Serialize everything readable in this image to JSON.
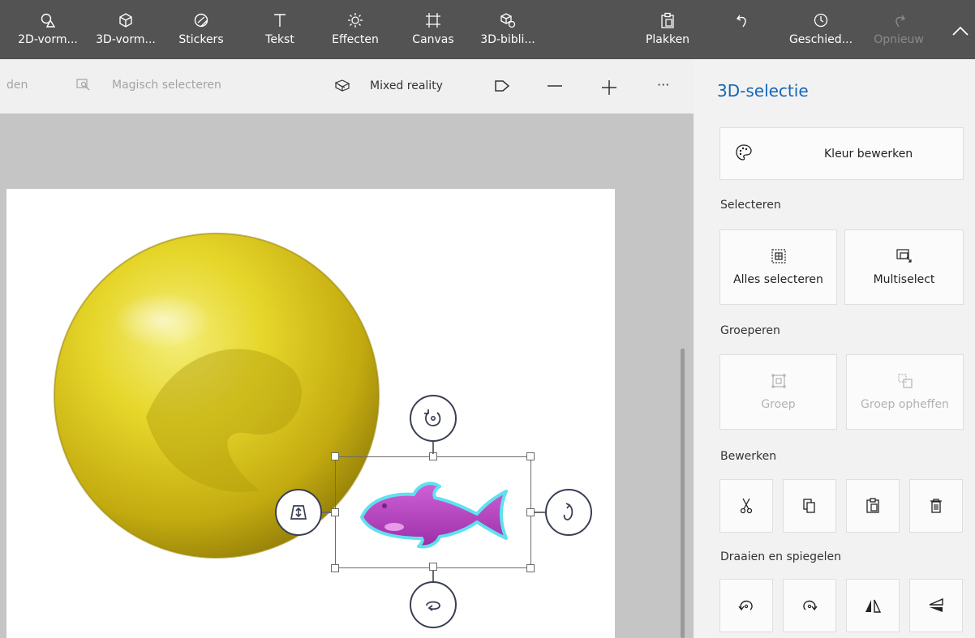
{
  "ribbon": {
    "items": [
      {
        "label": "2D-vorm...",
        "icon": "2d-shapes-icon"
      },
      {
        "label": "3D-vorm...",
        "icon": "3d-shapes-icon"
      },
      {
        "label": "Stickers",
        "icon": "stickers-icon"
      },
      {
        "label": "Tekst",
        "icon": "text-icon"
      },
      {
        "label": "Effecten",
        "icon": "effects-icon"
      },
      {
        "label": "Canvas",
        "icon": "canvas-icon"
      },
      {
        "label": "3D-bibli...",
        "icon": "3d-library-icon"
      },
      {
        "label": "Plakken",
        "icon": "paste-icon"
      },
      {
        "label": "Geschied...",
        "icon": "history-icon"
      },
      {
        "label": "Opnieuw",
        "icon": "redo-icon"
      }
    ]
  },
  "toolbar": {
    "partial_label": "den",
    "magic_select": "Magisch selecteren",
    "mixed_reality": "Mixed reality",
    "more": "···"
  },
  "panel": {
    "title": "3D-selectie",
    "edit_color": "Kleur bewerken",
    "select_header": "Selecteren",
    "select_all": "Alles selecteren",
    "multiselect": "Multiselect",
    "group_header": "Groeperen",
    "group": "Groep",
    "ungroup": "Groep opheffen",
    "edit_header": "Bewerken",
    "rotate_header": "Draaien en spiegelen"
  },
  "colors": {
    "ribbon": "#535353",
    "accent": "#1565b7",
    "sphere": "#d9c81a",
    "fish": "#b946c4",
    "fish_outline": "#5ee1f0"
  }
}
